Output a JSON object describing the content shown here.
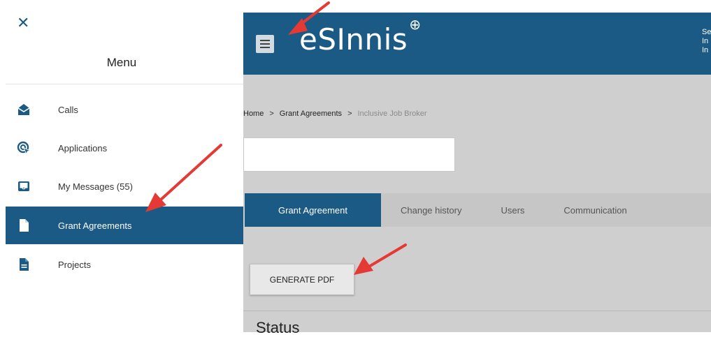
{
  "header": {
    "logo_text": "eSInnis",
    "logo_mark": "⊕",
    "right_text": "Se In In"
  },
  "breadcrumb": {
    "home": "Home",
    "sep": ">",
    "grant_agreements": "Grant Agreements",
    "current": "Inclusive Job Broker"
  },
  "tabs": [
    {
      "label": "Grant Agreement",
      "active": true
    },
    {
      "label": "Change history"
    },
    {
      "label": "Users"
    },
    {
      "label": "Communication"
    }
  ],
  "generate_pdf_label": "GENERATE PDF",
  "status_heading": "Status",
  "drawer": {
    "close_glyph": "✕",
    "title": "Menu",
    "items": [
      {
        "label": "Calls",
        "icon": "envelope-open-icon"
      },
      {
        "label": "Applications",
        "icon": "target-cursor-icon"
      },
      {
        "label": "My Messages (55)",
        "icon": "inbox-icon"
      },
      {
        "label": "Grant Agreements",
        "icon": "file-icon",
        "active": true
      },
      {
        "label": "Projects",
        "icon": "file-text-icon"
      }
    ]
  },
  "colors": {
    "brand": "#1a5a85",
    "annotation_arrow": "#e53935"
  }
}
